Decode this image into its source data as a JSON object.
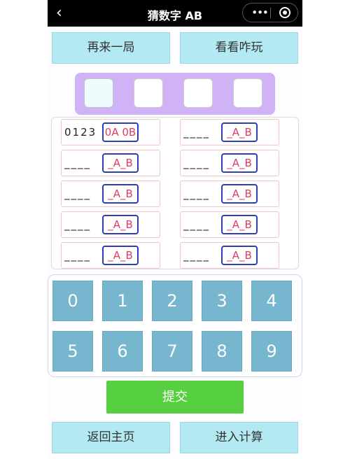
{
  "titlebar": {
    "back_icon": "‹",
    "title": "猜数字 AB",
    "more_icon": "•••"
  },
  "buttons": {
    "restart": "再来一局",
    "peek": "看看咋玩",
    "submit": "提交",
    "home": "返回主页",
    "calc": "进入计算"
  },
  "history": {
    "rows": [
      {
        "digits": "0123",
        "result": "0A 0B"
      },
      {
        "digits": "____",
        "result": "_A_B"
      },
      {
        "digits": "____",
        "result": "_A_B"
      },
      {
        "digits": "____",
        "result": "_A_B"
      },
      {
        "digits": "____",
        "result": "_A_B"
      },
      {
        "digits": "____",
        "result": "_A_B"
      },
      {
        "digits": "____",
        "result": "_A_B"
      },
      {
        "digits": "____",
        "result": "_A_B"
      },
      {
        "digits": "____",
        "result": "_A_B"
      },
      {
        "digits": "____",
        "result": "_A_B"
      }
    ]
  },
  "keypad": {
    "keys": [
      "0",
      "1",
      "2",
      "3",
      "4",
      "5",
      "6",
      "7",
      "8",
      "9"
    ]
  },
  "colors": {
    "accent_green": "#56d041",
    "key_blue": "#76b6cf",
    "light_button": "#b3e9f2",
    "slot_panel": "#d0b3f7",
    "result_text": "#e03c63",
    "result_border": "#2c3fb6"
  }
}
